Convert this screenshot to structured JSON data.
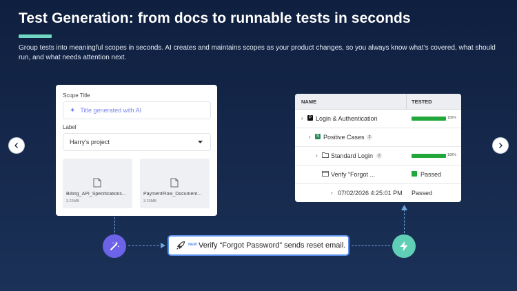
{
  "header": {
    "title": "Test Generation: from docs to runnable tests in seconds",
    "description": "Group tests into meaningful scopes in seconds. AI creates and maintains scopes as your product changes, so you always know what’s covered, what should run, and what needs attention next."
  },
  "nav": {
    "prev_icon": "chevron-left-icon",
    "next_icon": "chevron-right-icon"
  },
  "scope_form": {
    "scope_title_label": "Scope Title",
    "scope_title_placeholder": "Title generated with AI",
    "label_label": "Label",
    "label_value": "Harry’s project",
    "files": [
      {
        "name": "Billing_API_Specifications...",
        "size": "3.23MB"
      },
      {
        "name": "PaymentFlow_Document...",
        "size": "3.23MB"
      }
    ]
  },
  "test_table": {
    "col_name": "NAME",
    "col_tested": "TESTED",
    "rows": [
      {
        "label": "Login & Authentication",
        "badge": "P",
        "tested": "progress",
        "progress": 100,
        "pct_label": "100%"
      },
      {
        "label": "Positive Cases",
        "badge": "S",
        "count": "2"
      },
      {
        "label": "Standard Login",
        "count": "2",
        "tested": "progress",
        "progress": 100,
        "pct_label": "100%"
      },
      {
        "label": "Verify “Forgot ...",
        "tested": "Passed"
      },
      {
        "label": "07/02/2026 4:25:01 PM",
        "tested": "Passed"
      }
    ]
  },
  "pill": {
    "tag": "NEW",
    "text": "Verify “Forgot Password” sends reset email."
  },
  "colors": {
    "accent": "#6fd7c4",
    "success": "#22a83a",
    "magic_circle": "#6c63e8",
    "bolt_circle": "#5fd0b5",
    "ai_sparkle": "#6f7ff0"
  }
}
